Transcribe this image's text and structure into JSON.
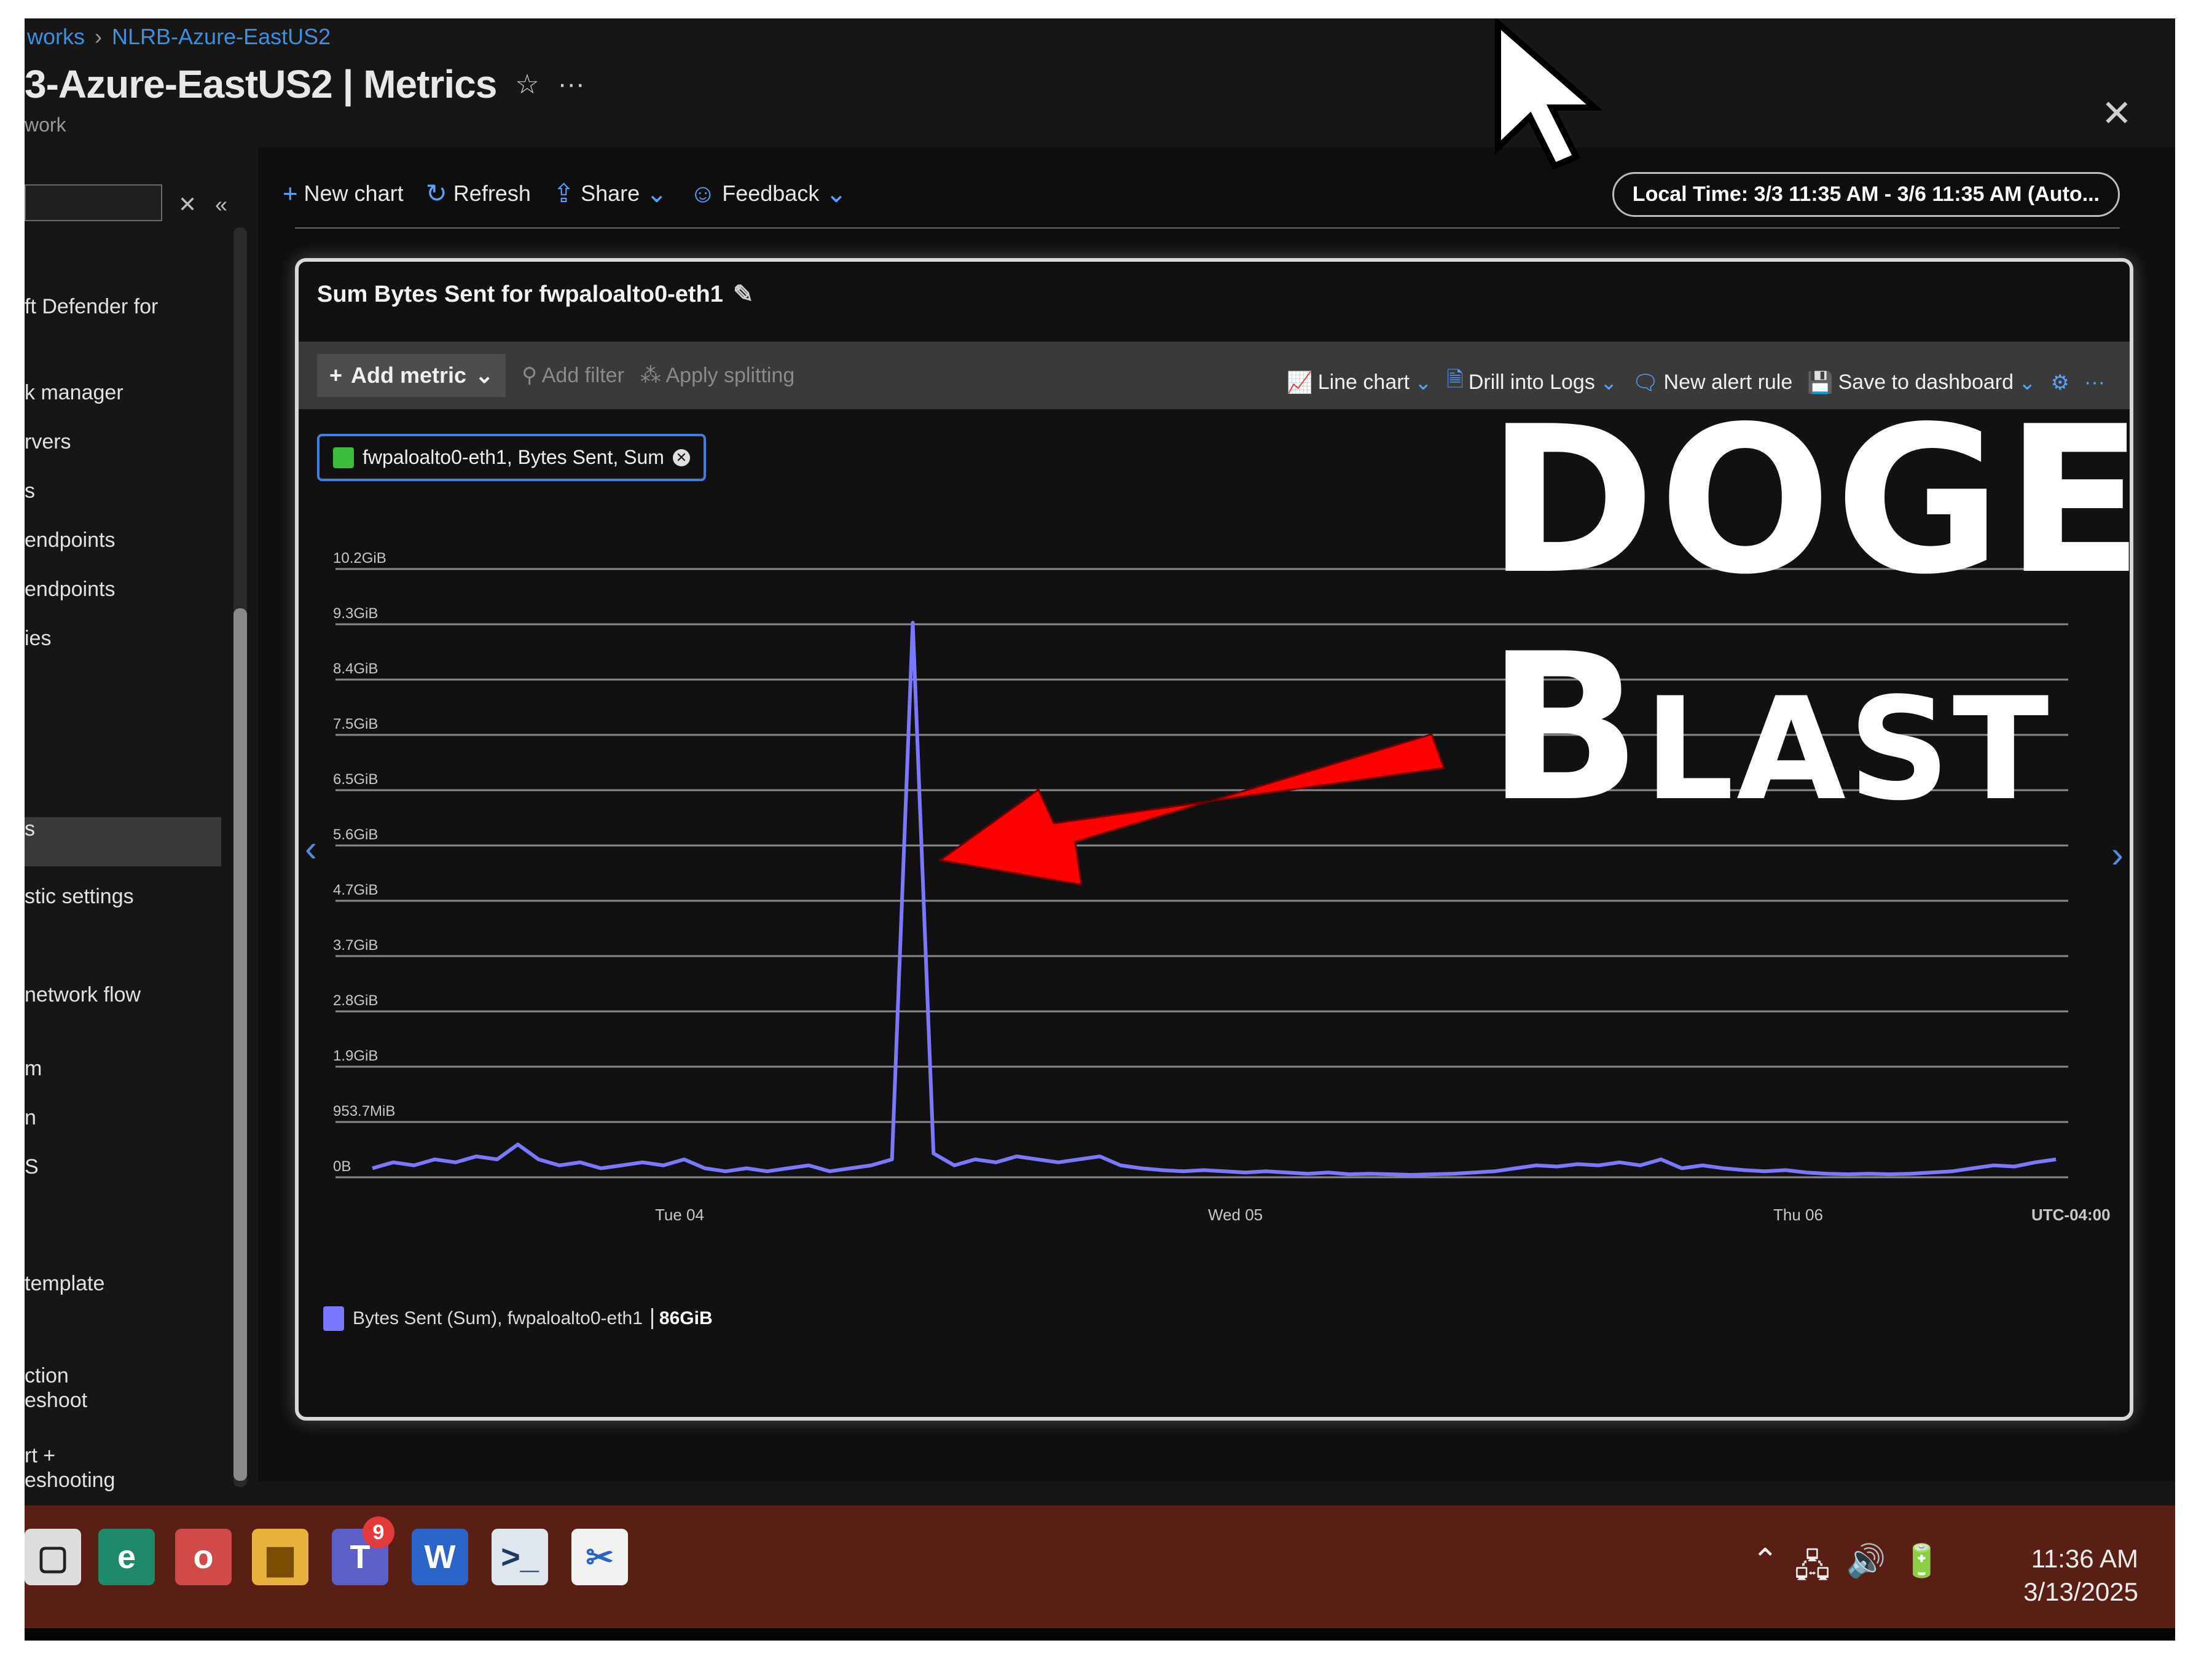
{
  "breadcrumb": {
    "parent": "works",
    "current": "NLRB-Azure-EastUS2"
  },
  "page": {
    "title": "3-Azure-EastUS2 | Metrics",
    "subtitle": "work",
    "close": "✕"
  },
  "sidebar": {
    "items": [
      "ft Defender for",
      "k manager",
      "rvers",
      "s",
      "endpoints",
      "endpoints",
      "ies",
      "s",
      "stic settings",
      "network flow",
      "m",
      "n",
      "S",
      "template",
      "ction",
      "eshoot",
      "rt +",
      "eshooting"
    ],
    "active_index": 7
  },
  "toolbar": {
    "new_chart": "New chart",
    "refresh": "Refresh",
    "share": "Share",
    "feedback": "Feedback",
    "time_range": "Local Time: 3/3 11:35 AM - 3/6 11:35 AM (Auto..."
  },
  "chart_card": {
    "title": "Sum Bytes Sent for fwpaloalto0-eth1",
    "add_metric": "Add metric",
    "add_filter": "Add filter",
    "apply_splitting": "Apply splitting",
    "line_chart": "Line chart",
    "drill_into_logs": "Drill into Logs",
    "new_alert_rule": "New alert rule",
    "save_to_dashboard": "Save to dashboard",
    "metric_pill": "fwpaloalto0-eth1, Bytes Sent, Sum",
    "legend_label": "Bytes Sent (Sum), fwpaloalto0-eth1",
    "legend_total": "86GiB"
  },
  "chart_data": {
    "type": "line",
    "y_ticks": [
      "0B",
      "953.7MiB",
      "1.9GiB",
      "2.8GiB",
      "3.7GiB",
      "4.7GiB",
      "5.6GiB",
      "6.5GiB",
      "7.5GiB",
      "8.4GiB",
      "9.3GiB",
      "10.2GiB"
    ],
    "ylim_gib": [
      0,
      10.2
    ],
    "x_ticks": [
      "Tue 04",
      "Wed 05",
      "Thu 06"
    ],
    "timezone": "UTC-04:00",
    "series": [
      {
        "name": "Bytes Sent (Sum), fwpaloalto0-eth1",
        "color": "#7a78ff",
        "values_gib": [
          0.15,
          0.25,
          0.2,
          0.3,
          0.25,
          0.35,
          0.3,
          0.55,
          0.3,
          0.2,
          0.25,
          0.15,
          0.2,
          0.25,
          0.2,
          0.3,
          0.15,
          0.1,
          0.15,
          0.1,
          0.15,
          0.2,
          0.1,
          0.15,
          0.2,
          0.3,
          9.3,
          0.4,
          0.2,
          0.3,
          0.25,
          0.35,
          0.3,
          0.25,
          0.3,
          0.35,
          0.2,
          0.15,
          0.12,
          0.1,
          0.12,
          0.1,
          0.08,
          0.1,
          0.08,
          0.06,
          0.08,
          0.05,
          0.06,
          0.05,
          0.04,
          0.05,
          0.06,
          0.08,
          0.1,
          0.15,
          0.2,
          0.18,
          0.22,
          0.2,
          0.25,
          0.2,
          0.3,
          0.15,
          0.2,
          0.15,
          0.12,
          0.1,
          0.12,
          0.08,
          0.06,
          0.05,
          0.06,
          0.05,
          0.06,
          0.08,
          0.1,
          0.15,
          0.2,
          0.18,
          0.25,
          0.3
        ]
      }
    ]
  },
  "overlay": {
    "line1": "DOGE",
    "line2_big": "B",
    "line2_small": "LAST"
  },
  "taskbar": {
    "teams_badge": "9",
    "time": "11:36 AM",
    "date": "3/13/2025"
  },
  "colors": {
    "accent": "#3d8fe0",
    "series": "#7a78ff",
    "arrow": "#ff0000",
    "taskbar": "#5a1f14"
  }
}
